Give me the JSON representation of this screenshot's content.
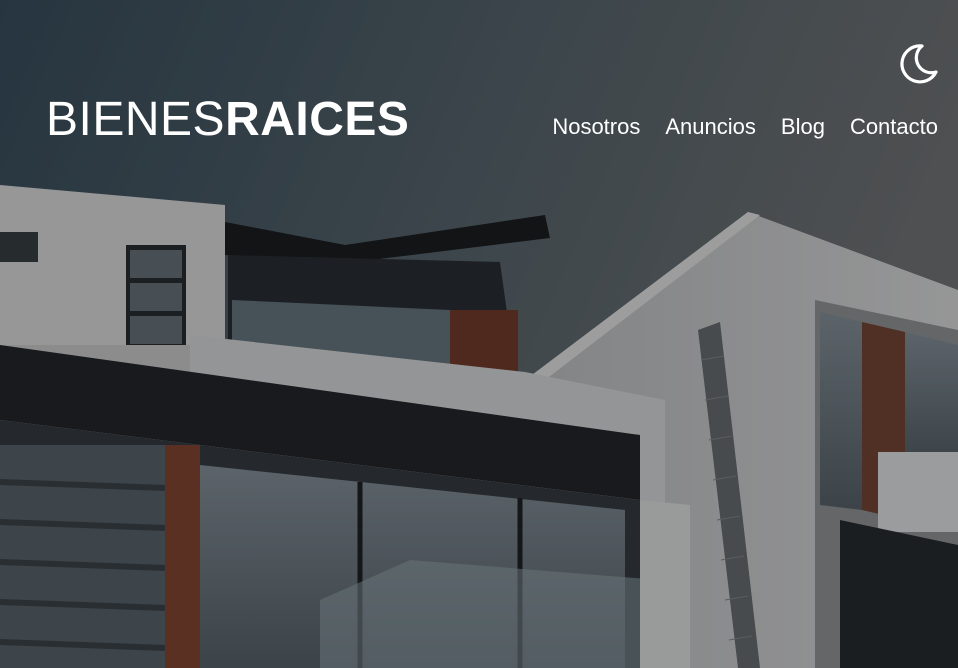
{
  "brand": {
    "light": "BIENES",
    "bold": "RAICES"
  },
  "nav": [
    {
      "label": "Nosotros"
    },
    {
      "label": "Anuncios"
    },
    {
      "label": "Blog"
    },
    {
      "label": "Contacto"
    }
  ],
  "theme_toggle": {
    "icon": "moon-icon"
  },
  "colors": {
    "overlay": "#000000",
    "text": "#ffffff",
    "sky": "#3f5564"
  }
}
